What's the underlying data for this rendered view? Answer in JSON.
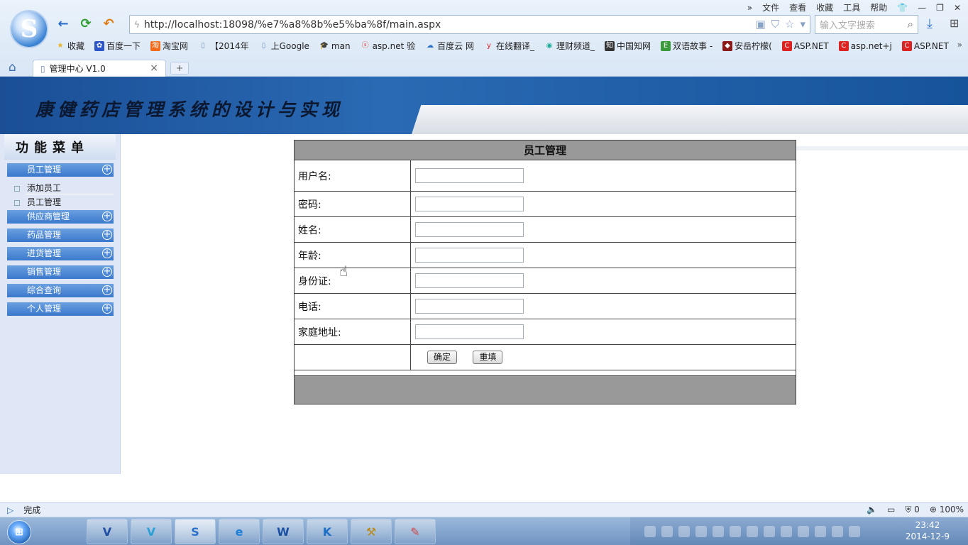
{
  "browser": {
    "menu": [
      "文件",
      "查看",
      "收藏",
      "工具",
      "帮助"
    ],
    "address": "http://localhost:18098/%e7%a8%8b%e5%ba%8f/main.aspx",
    "search_placeholder": "输入文字搜索",
    "bookmarks": [
      "收藏",
      "百度一下",
      "淘宝网",
      "【2014年",
      "上Google",
      "man",
      "asp.net 验",
      "百度云 网",
      "在线翻译_",
      "理财频道_",
      "中国知网",
      "双语故事 -",
      "安岳柠檬(",
      "ASP.NET",
      "asp.net+j",
      "ASP.NET"
    ],
    "tab_title": "管理中心 V1.0",
    "new_tab": "+"
  },
  "page": {
    "banner_title": "康健药店管理系统的设计与实现",
    "sidebar": {
      "head": "功能菜单",
      "menu": [
        "员工管理",
        "供应商管理",
        "药品管理",
        "进货管理",
        "销售管理",
        "综合查询",
        "个人管理"
      ],
      "sub_items": [
        "添加员工",
        "员工管理"
      ]
    },
    "form": {
      "caption": "员工管理",
      "fields": [
        {
          "label": "用户名:",
          "value": ""
        },
        {
          "label": "密码:",
          "value": ""
        },
        {
          "label": "姓名:",
          "value": ""
        },
        {
          "label": "年龄:",
          "value": ""
        },
        {
          "label": "身份证:",
          "value": ""
        },
        {
          "label": "电话:",
          "value": ""
        },
        {
          "label": "家庭地址:",
          "value": ""
        }
      ],
      "confirm_label": "确定",
      "reset_label": "重填"
    }
  },
  "status": {
    "text": "完成",
    "counter": "0",
    "zoom": "100%"
  },
  "taskbar": {
    "time": "23:42",
    "date": "2014-12-9"
  }
}
